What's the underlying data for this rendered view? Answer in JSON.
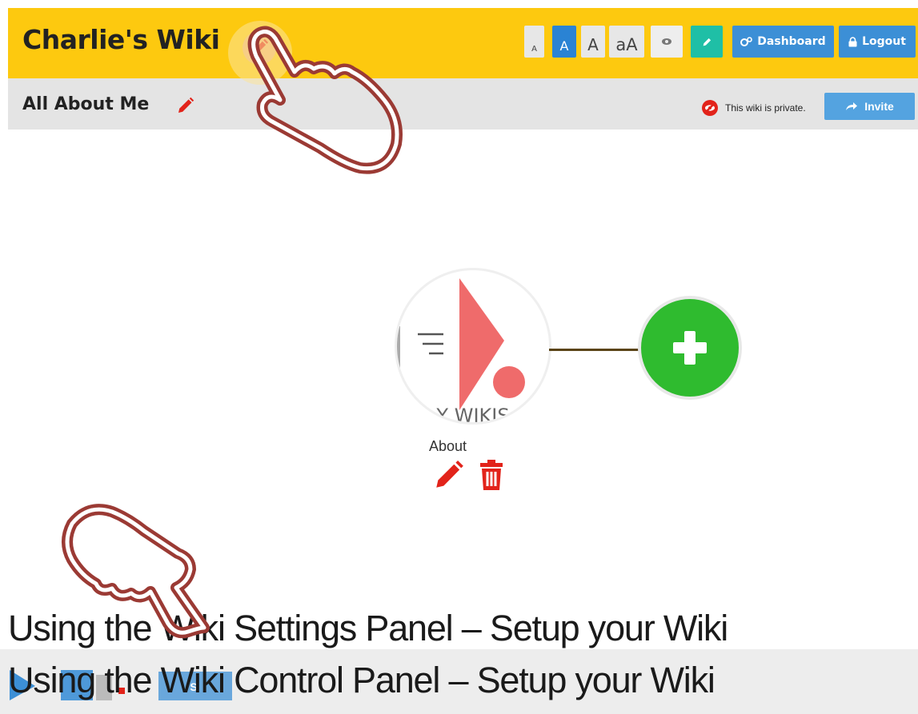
{
  "header": {
    "title": "Charlie's Wiki",
    "font_buttons": [
      {
        "label": "A"
      },
      {
        "label": "A"
      },
      {
        "label": "A"
      },
      {
        "label": "aA"
      }
    ],
    "dashboard_label": "Dashboard",
    "logout_label": "Logout"
  },
  "subheader": {
    "page_title": "All About Me",
    "private_text": "This wiki is private.",
    "invite_label": "Invite"
  },
  "main": {
    "node_image_text": "Y WIKIS",
    "node_label": "About"
  },
  "captions": {
    "line1": "Using the Wiki Settings Panel – Setup your Wiki",
    "line2": "Using the Wiki Control Panel – Setup your Wiki"
  },
  "bottom": {
    "partial_button_text": "S"
  },
  "colors": {
    "header_bg": "#fdc90f",
    "subheader_bg": "#e4e4e4",
    "accent_blue": "#3c8fd6",
    "teal": "#1fbfa6",
    "add_green": "#2fbb2f",
    "danger_red": "#e2231a",
    "hand_outline": "#9b3a34"
  },
  "icons": [
    "pencil-icon",
    "eye-icon",
    "gears-icon",
    "lock-icon",
    "share-icon",
    "private-eye-icon",
    "plus-icon",
    "trash-icon",
    "pointing-hand-icon"
  ]
}
